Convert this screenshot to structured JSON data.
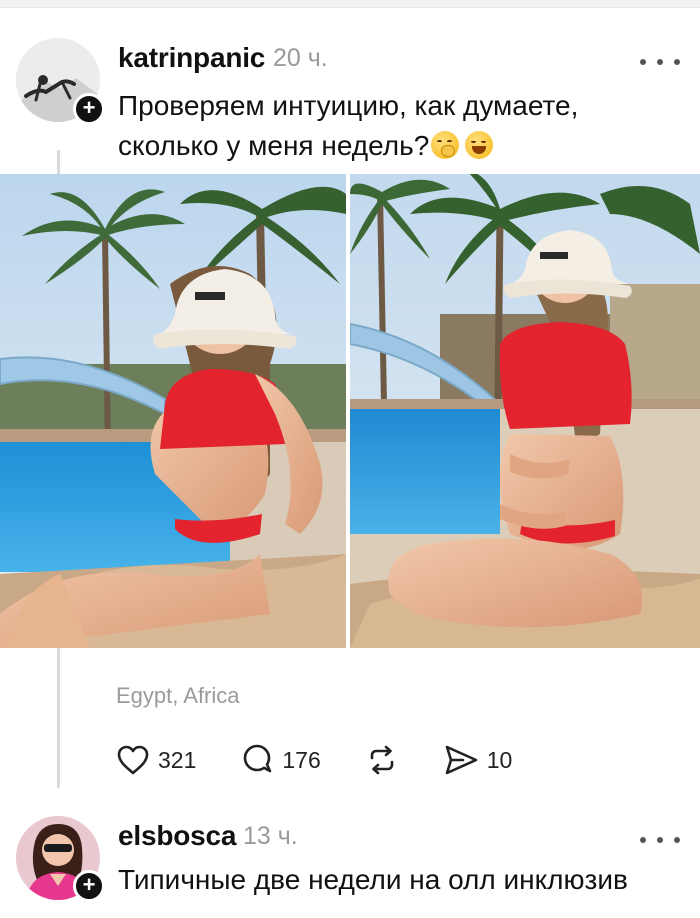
{
  "post": {
    "username": "katrinpanic",
    "time": "20 ч.",
    "text": "Проверяем интуицию, как думаете, сколько у меня недель?",
    "emojis": [
      "hand-over-mouth-emoji",
      "grinning-squint-emoji"
    ],
    "photos": [
      "pool-photo-sitting",
      "pool-photo-kneeling"
    ],
    "location": "Egypt, Africa",
    "stats": {
      "likes": "321",
      "comments": "176",
      "shares": "10"
    }
  },
  "reply": {
    "username": "elsbosca",
    "time": "13 ч.",
    "text": "Типичные две недели на олл инклюзив"
  },
  "icons": {
    "like": "heart-icon",
    "comment": "comment-bubble-icon",
    "repost": "repost-icon",
    "share": "send-icon",
    "more": "more-dots-icon",
    "follow": "plus-badge-icon"
  },
  "colors": {
    "accent": "#111111",
    "muted": "#9a9a9a",
    "swimsuit": "#e3232d",
    "pool": "#2e9fe0"
  }
}
